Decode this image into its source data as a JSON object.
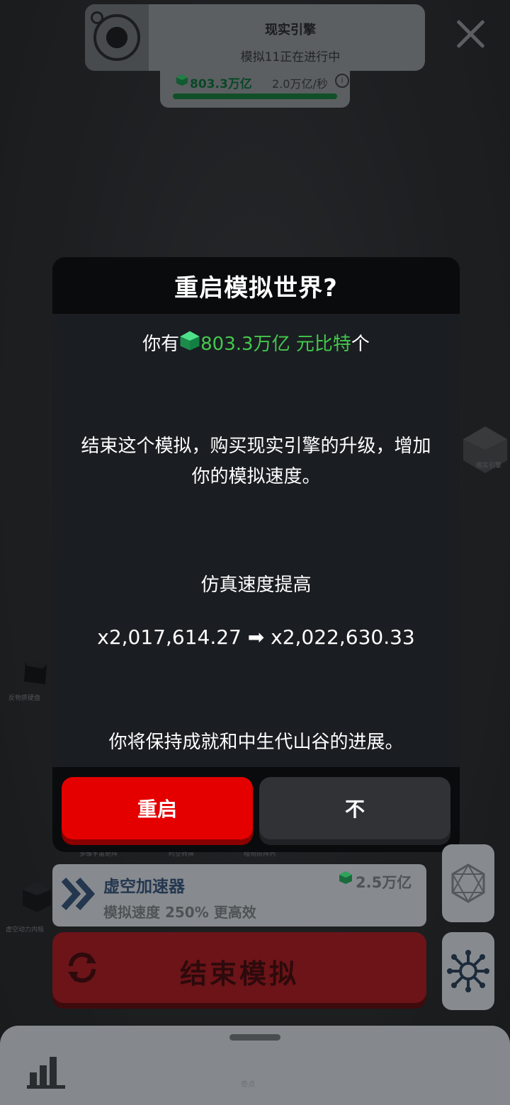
{
  "colors": {
    "accent_green": "#43c84d",
    "restart_red": "#e50000",
    "end_red": "#6c1418"
  },
  "banner": {
    "title": "现实引擎",
    "subtitle": "模拟11正在进行中",
    "icon": "reality-engine-icon"
  },
  "currency": {
    "amount": "803.3万亿",
    "rate": "2.0万亿/秒",
    "progress": 1.0
  },
  "side_nodes": {
    "right": "现实引擎",
    "left": "反物质硬盘",
    "left_bottom": "虚空动力内核",
    "faint_1": "多维宇宙矩阵",
    "faint_2": "时空转换",
    "faint_3": "暗物质阵列",
    "bottom": "奇点"
  },
  "modal": {
    "title": "重启模拟世界?",
    "have_prefix": "你有",
    "have_amount": "803.3万亿 元比特",
    "have_suffix": "个",
    "description": "结束这个模拟，购买现实引擎的升级，增加你的模拟速度。",
    "speed_title": "仿真速度提高",
    "speed_from": "x2,017,614.27",
    "speed_arrow": "➡",
    "speed_to": "x2,022,630.33",
    "keep_note": "你将保持成就和中生代山谷的进展。",
    "restart_label": "重启",
    "no_label": "不"
  },
  "upgrade": {
    "name": "虚空加速器",
    "effect": "模拟速度 250% 更高效",
    "price": "2.5万亿"
  },
  "end_button": {
    "label": "结束模拟"
  }
}
